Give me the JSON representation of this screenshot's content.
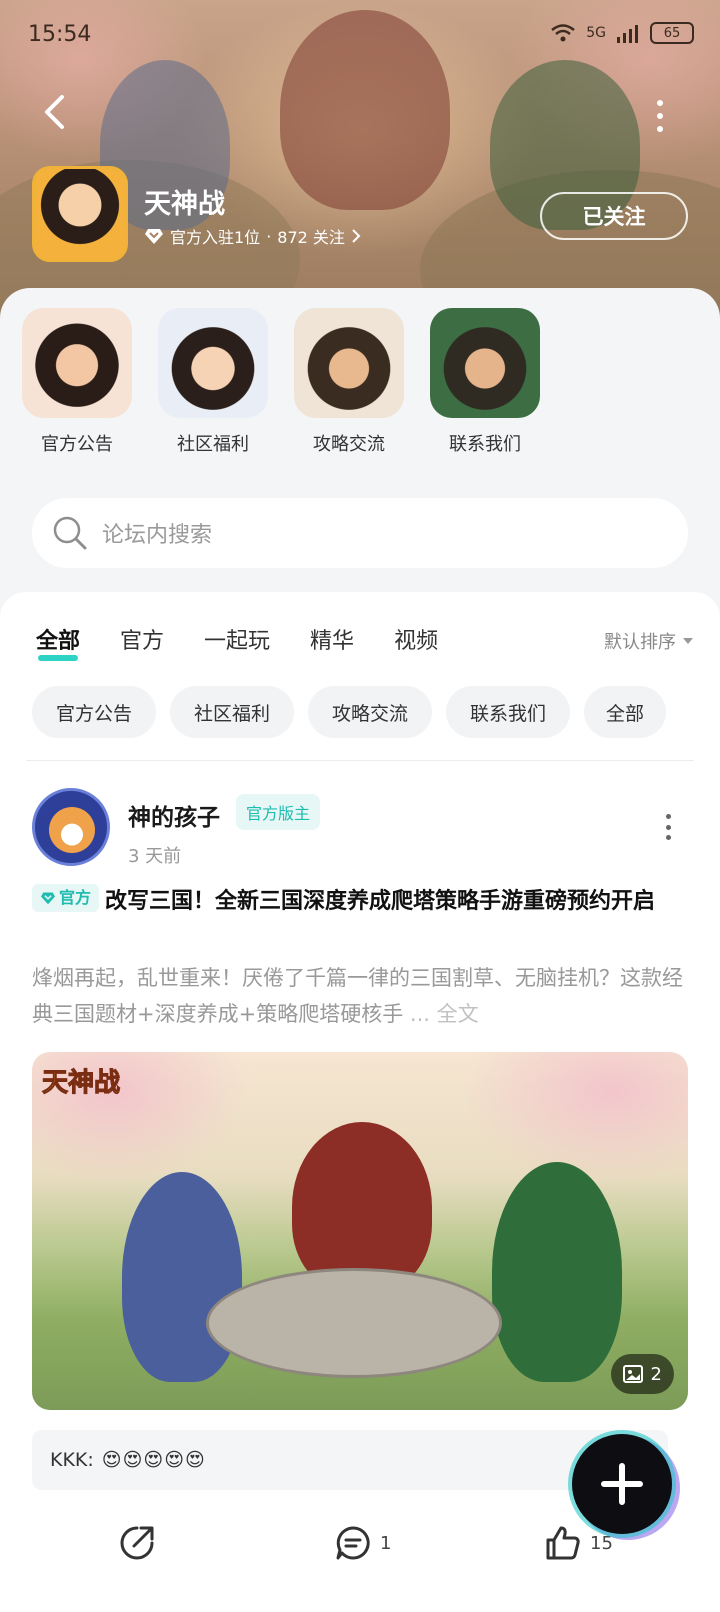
{
  "status_bar": {
    "time": "15:54",
    "network": "5G",
    "battery": "65"
  },
  "forum": {
    "name": "天神战",
    "meta_official": "官方入驻1位",
    "meta_separator": "·",
    "meta_follow": "872 关注",
    "follow_button": "已关注"
  },
  "quick_links": [
    {
      "label": "官方公告",
      "icon": "official-notice-icon"
    },
    {
      "label": "社区福利",
      "icon": "community-welfare-icon"
    },
    {
      "label": "攻略交流",
      "icon": "strategy-exchange-icon"
    },
    {
      "label": "联系我们",
      "icon": "contact-us-icon"
    }
  ],
  "search": {
    "placeholder": "论坛内搜索"
  },
  "tabs": [
    {
      "label": "全部",
      "active": true
    },
    {
      "label": "官方",
      "active": false
    },
    {
      "label": "一起玩",
      "active": false
    },
    {
      "label": "精华",
      "active": false
    },
    {
      "label": "视频",
      "active": false
    }
  ],
  "sort": {
    "label": "默认排序"
  },
  "chips": [
    "官方公告",
    "社区福利",
    "攻略交流",
    "联系我们",
    "全部"
  ],
  "post": {
    "author": "神的孩子",
    "author_badge": "官方版主",
    "time": "3 天前",
    "official_tag": "官方",
    "title": "改写三国！全新三国深度养成爬塔策略手游重磅预约开启",
    "body": "烽烟再起，乱世重来！厌倦了千篇一律的三国割草、无脑挂机？这款经典三国题材+深度养成+策略爬塔硬核手",
    "more": "... 全文",
    "image_logo": "天神战",
    "image_count": "2",
    "comment_user": "KKK:",
    "comment_text": "😍😍😍😍😍",
    "comments": "1",
    "likes": "15"
  },
  "colors": {
    "accent": "#2dd3c5",
    "badge_bg": "#e6f7f5",
    "badge_text": "#1fbcb0"
  }
}
